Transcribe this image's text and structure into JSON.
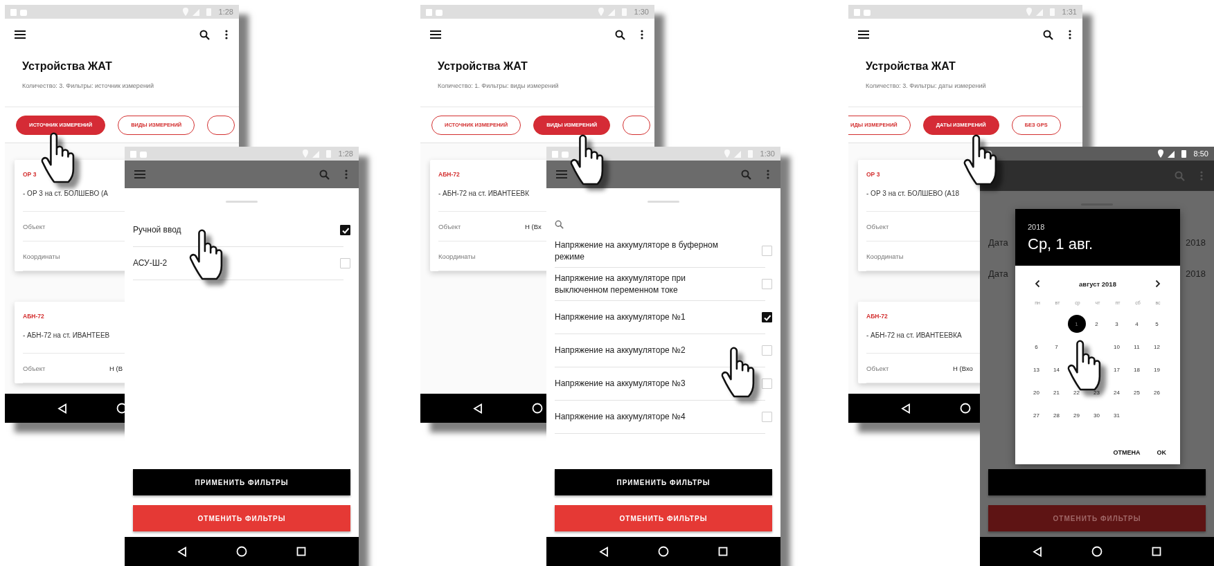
{
  "scenes": [
    {
      "main": {
        "status_time": "1:28",
        "title": "Устройства ЖАТ",
        "subtitle": "Количество: 3.  Фильтры: источник измерений",
        "chips_scrolled": false,
        "chips": [
          {
            "label": "ИСТОЧНИК ИЗМЕРЕНИЙ",
            "selected": true
          },
          {
            "label": "ВИДЫ ИЗМЕРЕНИЙ",
            "selected": false
          },
          {
            "selected": false
          }
        ],
        "cards": [
          {
            "name": "ОР 3",
            "description": "- ОР 3 на ст. БОЛШЕВО (А",
            "fields": [
              {
                "label": "Объект"
              },
              {
                "label": "Координаты"
              }
            ]
          },
          {
            "name": "АБН-72",
            "description": "- АБН-72 на ст. ИВАНТЕЕВ",
            "fields": [
              {
                "label": "Объект",
                "value": "Н (В"
              }
            ]
          }
        ]
      },
      "front": {
        "kind": "checklist",
        "status_time": "1:28",
        "search": false,
        "options": [
          {
            "label": "Ручной ввод",
            "checked": true
          },
          {
            "label": "АСУ-Ш-2",
            "checked": false
          }
        ],
        "buttons": [
          {
            "kind": "apply",
            "label": "ПРИМЕНИТЬ ФИЛЬТРЫ"
          },
          {
            "kind": "reset",
            "label": "ОТМЕНИТЬ ФИЛЬТРЫ"
          }
        ]
      }
    },
    {
      "main": {
        "status_time": "1:30",
        "title": "Устройства ЖАТ",
        "subtitle": "Количество: 1.  Фильтры: виды измерений",
        "chips_scrolled": false,
        "chips": [
          {
            "label": "ИСТОЧНИК ИЗМЕРЕНИЙ",
            "selected": false
          },
          {
            "label": "ВИДЫ ИЗМЕРЕНИЙ",
            "selected": true
          },
          {
            "selected": false
          }
        ],
        "cards": [
          {
            "name": "АБН-72",
            "description": "- АБН-72 на ст. ИВАНТЕЕВК",
            "fields": [
              {
                "label": "Объект",
                "value": "Н (Вх"
              },
              {
                "label": "Координаты"
              }
            ]
          }
        ]
      },
      "front": {
        "kind": "checklist",
        "status_time": "1:30",
        "search": true,
        "options": [
          {
            "label": "Напряжение на аккумуляторе в буферном режиме",
            "checked": false
          },
          {
            "label": "Напряжение на аккумуляторе при выключенном переменном токе",
            "checked": false
          },
          {
            "label": "Напряжение на аккумуляторе №1",
            "checked": true
          },
          {
            "label": "Напряжение на аккумуляторе №2",
            "checked": false
          },
          {
            "label": "Напряжение на аккумуляторе №3",
            "checked": false
          },
          {
            "label": "Напряжение на аккумуляторе №4",
            "checked": false
          }
        ],
        "buttons": [
          {
            "kind": "apply",
            "label": "ПРИМЕНИТЬ ФИЛЬТРЫ"
          },
          {
            "kind": "reset",
            "label": "ОТМЕНИТЬ ФИЛЬТРЫ"
          }
        ]
      }
    },
    {
      "main": {
        "status_time": "1:31",
        "title": "Устройства ЖАТ",
        "subtitle": "Количество: 3.  Фильтры: даты измерений",
        "chips_scrolled": true,
        "chips": [
          {
            "label": "ИДЫ ИЗМЕРЕНИЙ",
            "selected": false
          },
          {
            "label": "ДАТЫ ИЗМЕРЕНИЙ",
            "selected": true
          },
          {
            "label": "БЕЗ GPS",
            "selected": false
          }
        ],
        "cards": [
          {
            "name": "ОР 3",
            "description": "- ОР 3 на ст. БОЛШЕВО (А18",
            "fields": [
              {
                "label": "Объект"
              },
              {
                "label": "Координаты"
              }
            ]
          },
          {
            "name": "АБН-72",
            "description": "- АБН-72 на ст. ИВАНТЕЕВКА",
            "fields": [
              {
                "label": "Объект",
                "value": "Н (Вхо"
              }
            ]
          }
        ]
      },
      "front": {
        "kind": "date_picker",
        "status_time": "8:50",
        "background_rows": [
          {
            "label": "Дата",
            "value": "2018"
          },
          {
            "label": "Дата",
            "value": "2018"
          }
        ],
        "buttons": [
          {
            "kind": "apply"
          },
          {
            "kind": "reset",
            "label": "ОТМЕНИТЬ ФИЛЬТРЫ"
          }
        ],
        "dialog": {
          "year": "2018",
          "date": "Ср, 1 авг.",
          "month": "август 2018",
          "weekdays": [
            "пн",
            "вт",
            "ср",
            "чт",
            "пт",
            "сб",
            "вс"
          ],
          "weeks": [
            [
              {
                "kind": "blank"
              },
              {
                "kind": "blank"
              },
              {
                "kind": "day",
                "day": "1",
                "selected": true
              },
              {
                "day": "2",
                "selected": false
              },
              {
                "day": "3",
                "selected": false
              },
              {
                "day": "4",
                "selected": false
              },
              {
                "day": "5",
                "selected": false
              }
            ],
            [
              {
                "day": "6",
                "selected": false
              },
              {
                "day": "7",
                "selected": false
              },
              {
                "kind": "blank"
              },
              {
                "kind": "blank"
              },
              {
                "day": "10",
                "selected": false
              },
              {
                "day": "11",
                "selected": false
              },
              {
                "day": "12",
                "selected": false
              }
            ],
            [
              {
                "day": "13",
                "selected": false
              },
              {
                "day": "14",
                "selected": false
              },
              {
                "kind": "blank"
              },
              {
                "kind": "blank"
              },
              {
                "day": "17",
                "selected": false
              },
              {
                "day": "18",
                "selected": false
              },
              {
                "day": "19",
                "selected": false
              }
            ],
            [
              {
                "day": "20",
                "selected": false
              },
              {
                "day": "21",
                "selected": false
              },
              {
                "day": "22",
                "selected": false
              },
              {
                "day": "23",
                "selected": false
              },
              {
                "day": "24",
                "selected": false
              },
              {
                "day": "25",
                "selected": false
              },
              {
                "day": "26",
                "selected": false
              }
            ],
            [
              {
                "day": "27",
                "selected": false
              },
              {
                "day": "28",
                "selected": false
              },
              {
                "day": "29",
                "selected": false
              },
              {
                "day": "30",
                "selected": false
              },
              {
                "day": "31",
                "selected": false
              },
              {
                "kind": "blank"
              },
              {
                "kind": "blank"
              }
            ]
          ],
          "actions": [
            "ОТМЕНА",
            "OK"
          ]
        }
      }
    }
  ]
}
